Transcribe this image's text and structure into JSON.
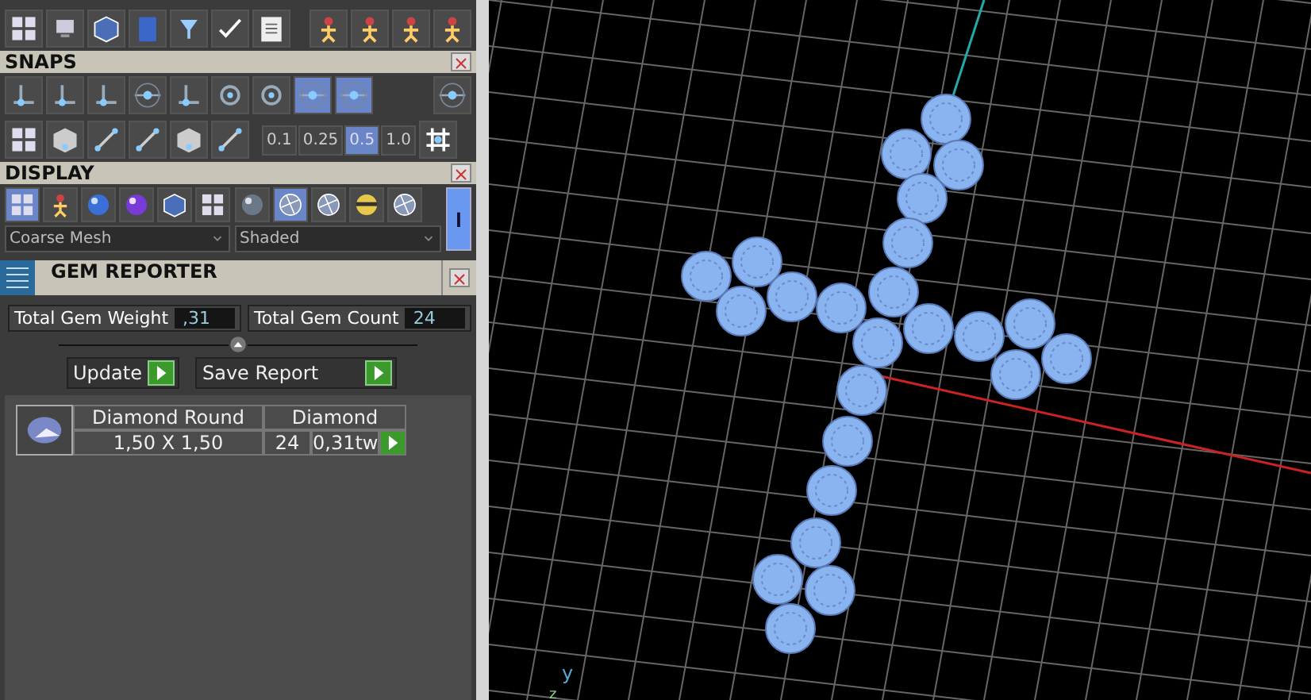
{
  "snaps": {
    "title": "SNAPS",
    "snap_buttons": [
      {
        "selected": false
      },
      {
        "selected": false
      },
      {
        "selected": false
      },
      {
        "selected": false
      },
      {
        "selected": false
      },
      {
        "selected": false
      },
      {
        "selected": false
      },
      {
        "selected": true
      },
      {
        "selected": true
      }
    ],
    "steps": [
      {
        "label": "0.1",
        "selected": false
      },
      {
        "label": "0.25",
        "selected": false
      },
      {
        "label": "0.5",
        "selected": true
      },
      {
        "label": "1.0",
        "selected": false
      }
    ]
  },
  "display": {
    "title": "DISPLAY",
    "mesh_modes": [
      {
        "selected": true
      },
      {
        "selected": false
      },
      {
        "selected": false
      },
      {
        "selected": false
      }
    ],
    "shade_modes": [
      {
        "selected": false
      },
      {
        "selected": true
      },
      {
        "selected": false
      },
      {
        "selected": false
      },
      {
        "selected": false
      }
    ],
    "mesh_dropdown": "Coarse Mesh",
    "shade_dropdown": "Shaded",
    "toggle": {
      "on": true,
      "label": "I"
    }
  },
  "gem_reporter": {
    "title": "GEM REPORTER",
    "totals": [
      {
        "label": "Total Gem Weight",
        "value": ",31"
      },
      {
        "label": "Total Gem Count",
        "value": "24"
      }
    ],
    "buttons": [
      "Update",
      "Save Report"
    ],
    "gems": [
      {
        "name": "Diamond Round",
        "material": "Diamond",
        "size": "1,50 X 1,50",
        "count": "24",
        "weight": "0,31tw"
      }
    ]
  },
  "viewport": {
    "axis_labels": [
      "y",
      "z"
    ]
  }
}
